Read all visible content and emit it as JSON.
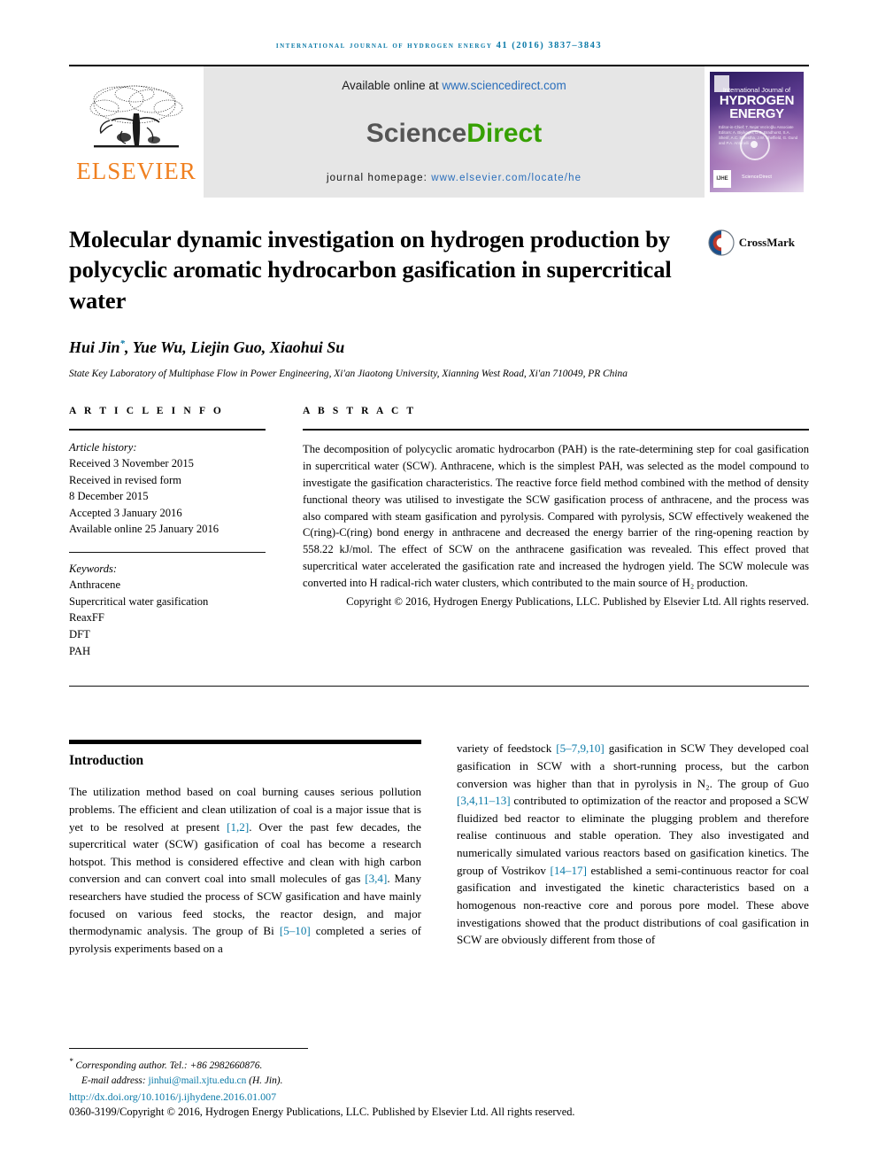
{
  "running_head": "International Journal of Hydrogen Energy 41 (2016) 3837–3843",
  "masthead": {
    "publisher_name": "ELSEVIER",
    "available_prefix": "Available online at ",
    "available_url": "www.sciencedirect.com",
    "sciencedirect_part1": "Science",
    "sciencedirect_part2": "Direct",
    "homepage_label": "journal homepage: ",
    "homepage_url": "www.elsevier.com/locate/he",
    "cover": {
      "line1": "International Journal of",
      "line2": "HYDROGEN",
      "line3": "ENERGY",
      "editors": "Editor-in-Chief: T. Nejat Veziroğlu    Associate Editors: A. Biyikoglu, D.S. Bradhurst, S.A. Sherif, A.C. Shrestha, J.W. Sheffield, G. Gund and P.A. Antonelli",
      "sd_badge": "ScienceDirect",
      "corner_badge": "IJHE"
    }
  },
  "article": {
    "title": "Molecular dynamic investigation on hydrogen production by polycyclic aromatic hydrocarbon gasification in supercritical water",
    "crossmark_label": "CrossMark",
    "authors": "Hui Jin",
    "author_marker": "*",
    "authors_rest": ", Yue Wu, Liejin Guo, Xiaohui Su",
    "affiliation": "State Key Laboratory of Multiphase Flow in Power Engineering, Xi'an Jiaotong University, Xianning West Road, Xi'an 710049, PR China"
  },
  "article_info": {
    "heading": "A R T I C L E  I N F O",
    "history_label": "Article history:",
    "history": [
      "Received 3 November 2015",
      "Received in revised form",
      "8 December 2015",
      "Accepted 3 January 2016",
      "Available online 25 January 2016"
    ],
    "keywords_label": "Keywords:",
    "keywords": [
      "Anthracene",
      "Supercritical water gasification",
      "ReaxFF",
      "DFT",
      "PAH"
    ]
  },
  "abstract": {
    "heading": "A B S T R A C T",
    "body": "The decomposition of polycyclic aromatic hydrocarbon (PAH) is the rate-determining step for coal gasification in supercritical water (SCW). Anthracene, which is the simplest PAH, was selected as the model compound to investigate the gasification characteristics. The reactive force field method combined with the method of density functional theory was utilised to investigate the SCW gasification process of anthracene, and the process was also compared with steam gasification and pyrolysis. Compared with pyrolysis, SCW effectively weakened the C(ring)-C(ring) bond energy in anthracene and decreased the energy barrier of the ring-opening reaction by 558.22 kJ/mol. The effect of SCW on the anthracene gasification was revealed. This effect proved that supercritical water accelerated the gasification rate and increased the hydrogen yield. The SCW molecule was converted into H radical-rich water clusters, which contributed to the main source of H₂ production.",
    "copyright": "Copyright © 2016, Hydrogen Energy Publications, LLC. Published by Elsevier Ltd. All rights reserved."
  },
  "introduction": {
    "heading": "Introduction",
    "left_para_a": "The utilization method based on coal burning causes serious pollution problems. The efficient and clean utilization of coal is a major issue that is yet to be resolved at present ",
    "cite_1": "[1,2]",
    "left_para_b": ". Over the past few decades, the supercritical water (SCW) gasification of coal has become a research hotspot. This method is considered effective and clean with high carbon conversion and can convert coal into small molecules of gas ",
    "cite_2": "[3,4]",
    "left_para_c": ". Many researchers have studied the process of SCW gasification and have mainly focused on various feed stocks, the reactor design, and major thermodynamic analysis. The group of Bi ",
    "cite_3": "[5–10]",
    "left_para_d": " completed a series of pyrolysis experiments based on a",
    "right_para_a": "variety of feedstock ",
    "cite_4": "[5–7,9,10]",
    "right_para_b": " gasification in SCW They developed coal gasification in SCW with a short-running process, but the carbon conversion was higher than that in pyrolysis in N₂. The group of Guo ",
    "cite_5": "[3,4,11–13]",
    "right_para_c": " contributed to optimization of the reactor and proposed a SCW fluidized bed reactor to eliminate the plugging problem and therefore realise continuous and stable operation. They also investigated and numerically simulated various reactors based on gasification kinetics. The group of Vostrikov ",
    "cite_6": "[14–17]",
    "right_para_d": " established a semi-continuous reactor for coal gasification and investigated the kinetic characteristics based on a homogenous non-reactive core and porous pore model. These above investigations showed that the product distributions of coal gasification in SCW are obviously different from those of"
  },
  "footer": {
    "corresponding_marker": "*",
    "corresponding": " Corresponding author. Tel.: +86 2982660876.",
    "email_label": "E-mail address: ",
    "email": "jinhui@mail.xjtu.edu.cn",
    "email_suffix": " (H. Jin).",
    "doi": "http://dx.doi.org/10.1016/j.ijhydene.2016.01.007",
    "copyright": "0360-3199/Copyright © 2016, Hydrogen Energy Publications, LLC. Published by Elsevier Ltd. All rights reserved."
  },
  "colors": {
    "journal_blue": "#0b7aa8",
    "link_blue": "#2a6ebb",
    "sciencedirect_green": "#36a000",
    "elsevier_orange": "#f08020"
  }
}
